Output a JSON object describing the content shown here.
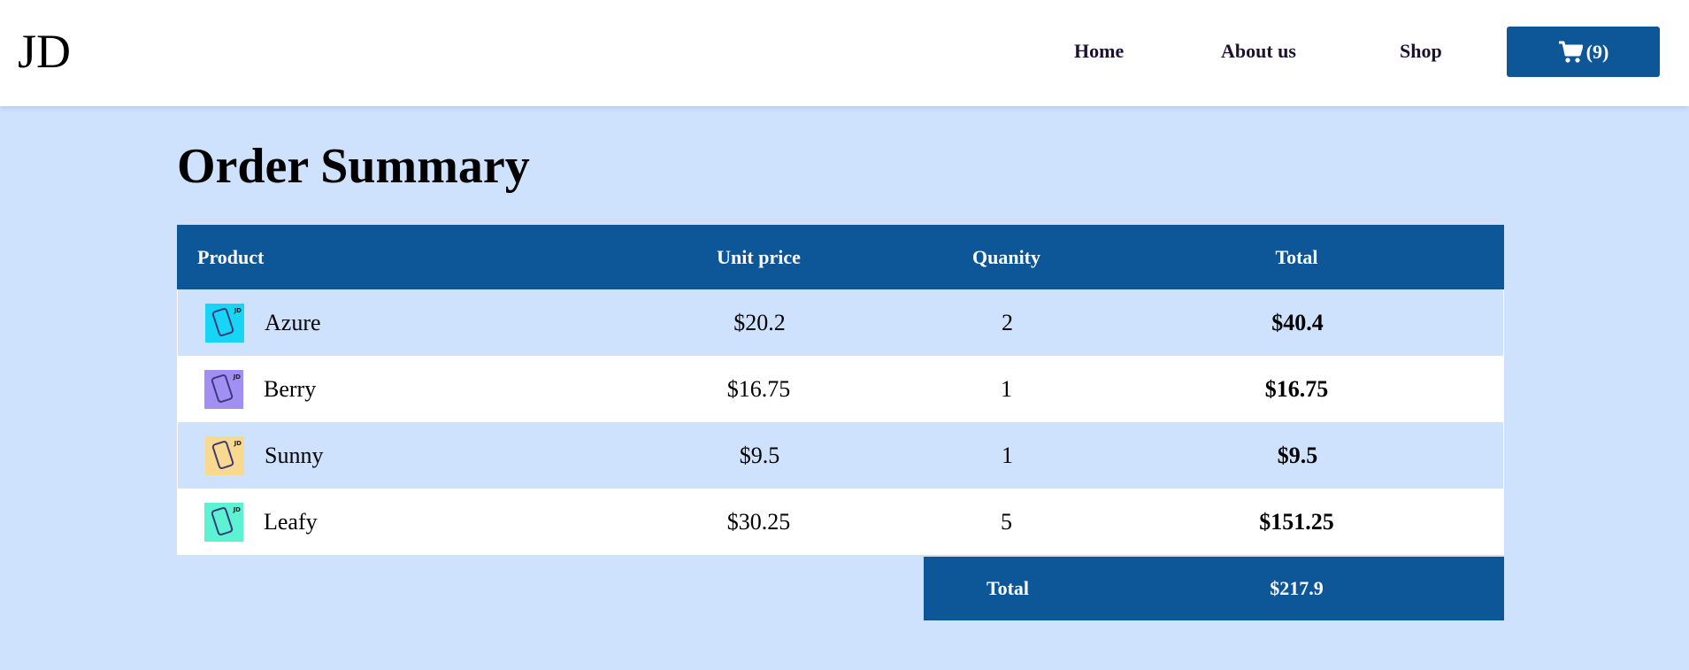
{
  "header": {
    "logo": "JD",
    "nav": {
      "home": "Home",
      "about": "About us",
      "shop": "Shop"
    },
    "cart_label": "(9)",
    "cart_icon": "shopping-cart-icon"
  },
  "main": {
    "title": "Order Summary",
    "table": {
      "headers": {
        "product": "Product",
        "unit_price": "Unit price",
        "quantity": "Quanity",
        "total": "Total"
      },
      "rows": [
        {
          "name": "Azure",
          "unit_price": "$20.2",
          "quantity": "2",
          "total": "$40.4",
          "thumb_color": "#17d6f5",
          "icon": "phone-case-azure-icon"
        },
        {
          "name": "Berry",
          "unit_price": "$16.75",
          "quantity": "1",
          "total": "$16.75",
          "thumb_color": "#a28ff4",
          "icon": "phone-case-berry-icon"
        },
        {
          "name": "Sunny",
          "unit_price": "$9.5",
          "quantity": "1",
          "total": "$9.5",
          "thumb_color": "#f9d98f",
          "icon": "phone-case-sunny-icon"
        },
        {
          "name": "Leafy",
          "unit_price": "$30.25",
          "quantity": "5",
          "total": "$151.25",
          "thumb_color": "#5cf2d2",
          "icon": "phone-case-leafy-icon"
        }
      ],
      "summary": {
        "label": "Total",
        "value": "$217.9"
      }
    }
  },
  "colors": {
    "brand": "#0d5799",
    "page_background": "#cfe2fd",
    "header_background": "#ffffff"
  }
}
